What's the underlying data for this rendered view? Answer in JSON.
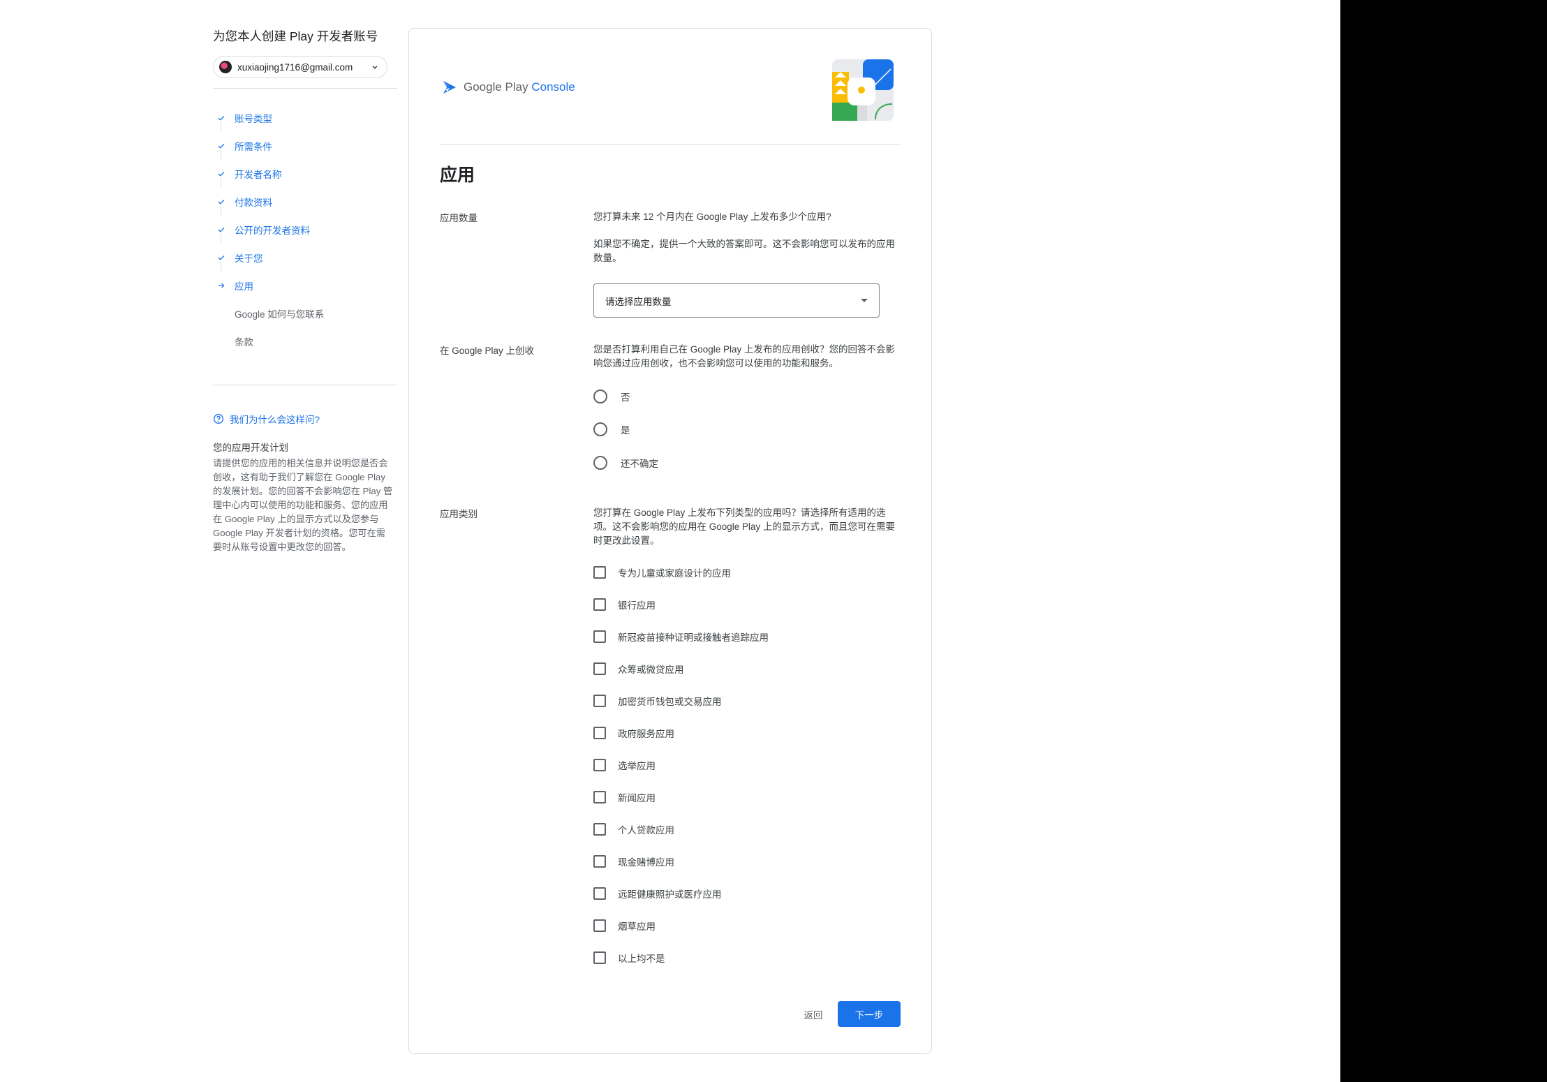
{
  "sidebar": {
    "title": "为您本人创建 Play 开发者账号",
    "account_email": "xuxiaojing1716@gmail.com",
    "steps": [
      {
        "label": "账号类型",
        "state": "done"
      },
      {
        "label": "所需条件",
        "state": "done"
      },
      {
        "label": "开发者名称",
        "state": "done"
      },
      {
        "label": "付款资料",
        "state": "done"
      },
      {
        "label": "公开的开发者资料",
        "state": "done"
      },
      {
        "label": "关于您",
        "state": "done"
      },
      {
        "label": "应用",
        "state": "current"
      },
      {
        "label": "Google 如何与您联系",
        "state": "pending"
      },
      {
        "label": "条款",
        "state": "pending"
      }
    ],
    "why_label": "我们为什么会这样问?",
    "plan_title": "您的应用开发计划",
    "plan_body": "请提供您的应用的相关信息并说明您是否会创收，这有助于我们了解您在 Google Play 的发展计划。您的回答不会影响您在 Play 管理中心内可以使用的功能和服务、您的应用在 Google Play 上的显示方式以及您参与 Google Play 开发者计划的资格。您可在需要时从账号设置中更改您的回答。"
  },
  "main": {
    "brand_google_play": "Google Play",
    "brand_console": "Console",
    "page_title": "应用",
    "app_count": {
      "label": "应用数量",
      "question": "您打算未来 12 个月内在 Google Play 上发布多少个应用?",
      "hint": "如果您不确定，提供一个大致的答案即可。这不会影响您可以发布的应用数量。",
      "select_placeholder": "请选择应用数量"
    },
    "monetize": {
      "label": "在 Google Play 上创收",
      "question": "您是否打算利用自己在 Google Play 上发布的应用创收？您的回答不会影响您通过应用创收，也不会影响您可以使用的功能和服务。",
      "options": [
        "否",
        "是",
        "还不确定"
      ]
    },
    "categories": {
      "label": "应用类别",
      "question": "您打算在 Google Play 上发布下列类型的应用吗？请选择所有适用的选项。这不会影响您的应用在 Google Play 上的显示方式，而且您可在需要时更改此设置。",
      "options": [
        "专为儿童或家庭设计的应用",
        "银行应用",
        "新冠疫苗接种证明或接触者追踪应用",
        "众筹或微贷应用",
        "加密货币钱包或交易应用",
        "政府服务应用",
        "选举应用",
        "新闻应用",
        "个人贷款应用",
        "现金赌博应用",
        "远距健康照护或医疗应用",
        "烟草应用",
        "以上均不是"
      ]
    },
    "back_label": "返回",
    "next_label": "下一步"
  },
  "colors": {
    "accent": "#1a73e8",
    "text": "#202124",
    "secondary_text": "#5f6368",
    "border": "#dadce0"
  }
}
